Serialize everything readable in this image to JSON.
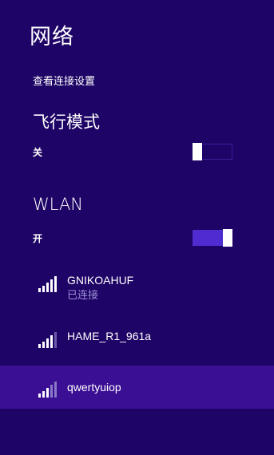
{
  "header": {
    "title": "网络",
    "settings_link": "查看连接设置"
  },
  "airplane": {
    "title": "飞行模式",
    "state_label": "关",
    "on": false
  },
  "wlan": {
    "title": "WLAN",
    "state_label": "开",
    "on": true
  },
  "networks": [
    {
      "name": "GNIKOAHUF",
      "status": "已连接",
      "signal": "wifi-signal-icon"
    },
    {
      "name": "HAME_R1_961a",
      "status": "",
      "signal": "wifi-signal-icon"
    },
    {
      "name": "qwertyuiop",
      "status": "",
      "signal": "wifi-signal-icon"
    }
  ],
  "colors": {
    "background": "#1e0466",
    "selected_row": "#3a0f94",
    "toggle_on": "#4e2cd0",
    "status_text": "#9f92d8"
  }
}
